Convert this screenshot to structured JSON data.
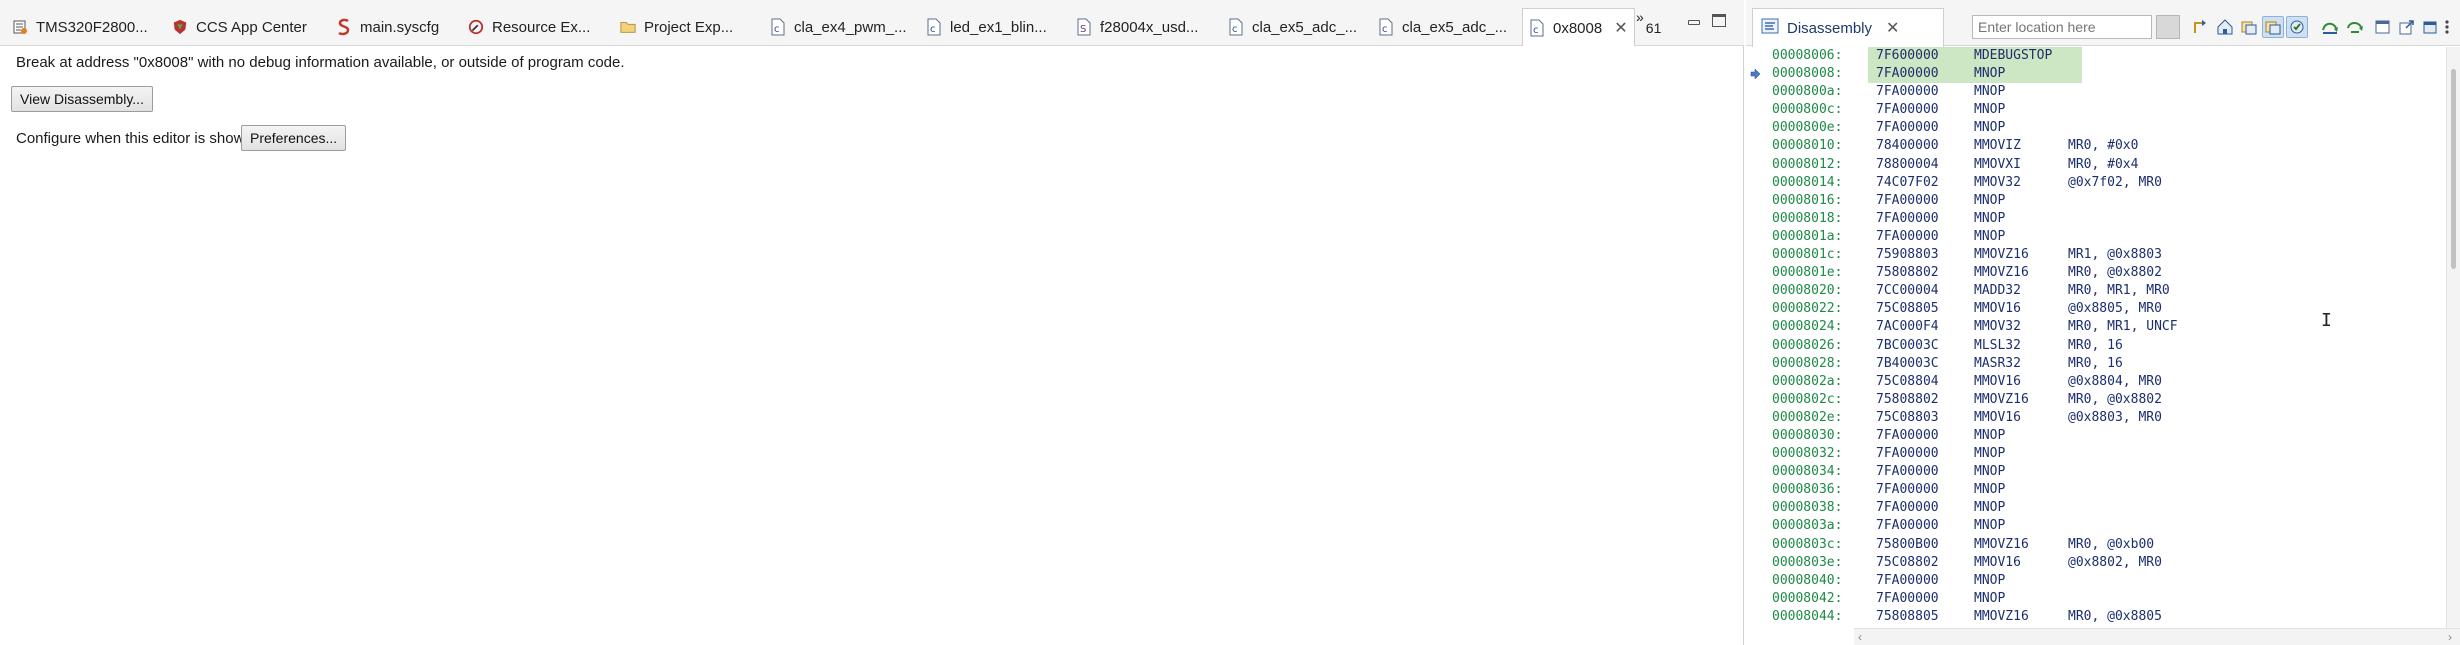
{
  "tabs": [
    {
      "label": "TMS320F2800...",
      "icon": "target-config-icon",
      "active": false
    },
    {
      "label": "CCS App Center",
      "icon": "app-center-icon",
      "active": false
    },
    {
      "label": "main.syscfg",
      "icon": "syscfg-icon",
      "active": false
    },
    {
      "label": "Resource Ex...",
      "icon": "resource-explorer-icon",
      "active": false
    },
    {
      "label": "Project Exp...",
      "icon": "folder-icon",
      "active": false
    },
    {
      "label": "cla_ex4_pwm_...",
      "icon": "c-file-icon",
      "active": false
    },
    {
      "label": "led_ex1_blin...",
      "icon": "c-file-icon",
      "active": false
    },
    {
      "label": "f28004x_usd...",
      "icon": "source-file-icon",
      "active": false
    },
    {
      "label": "cla_ex5_adc_...",
      "icon": "c-file-icon",
      "active": false
    },
    {
      "label": "cla_ex5_adc_...",
      "icon": "c-file-icon",
      "active": false
    },
    {
      "label": "0x8008",
      "icon": "c-file-icon",
      "active": true
    }
  ],
  "overflow": {
    "chevron": "»",
    "count": "61"
  },
  "editor": {
    "message": "Break at address \"0x8008\" with no debug information available, or outside of program code.",
    "view_disassembly_label": "View Disassembly...",
    "configure_label": "Configure when this editor is shown",
    "preferences_label": "Preferences..."
  },
  "disassembly": {
    "tab_label": "Disassembly",
    "location_placeholder": "Enter location here",
    "rows": [
      {
        "addr": "00008006:",
        "op": "7F600000",
        "mn": "MDEBUGSTOP",
        "args": "",
        "hl": true
      },
      {
        "addr": "00008008:",
        "op": "7FA00000",
        "mn": "MNOP",
        "args": "",
        "hl": true
      },
      {
        "addr": "0000800a:",
        "op": "7FA00000",
        "mn": "MNOP",
        "args": ""
      },
      {
        "addr": "0000800c:",
        "op": "7FA00000",
        "mn": "MNOP",
        "args": ""
      },
      {
        "addr": "0000800e:",
        "op": "7FA00000",
        "mn": "MNOP",
        "args": ""
      },
      {
        "addr": "00008010:",
        "op": "78400000",
        "mn": "MMOVIZ",
        "args": "MR0, #0x0"
      },
      {
        "addr": "00008012:",
        "op": "78800004",
        "mn": "MMOVXI",
        "args": "MR0, #0x4"
      },
      {
        "addr": "00008014:",
        "op": "74C07F02",
        "mn": "MMOV32",
        "args": "@0x7f02, MR0"
      },
      {
        "addr": "00008016:",
        "op": "7FA00000",
        "mn": "MNOP",
        "args": ""
      },
      {
        "addr": "00008018:",
        "op": "7FA00000",
        "mn": "MNOP",
        "args": ""
      },
      {
        "addr": "0000801a:",
        "op": "7FA00000",
        "mn": "MNOP",
        "args": ""
      },
      {
        "addr": "0000801c:",
        "op": "75908803",
        "mn": "MMOVZ16",
        "args": "MR1, @0x8803"
      },
      {
        "addr": "0000801e:",
        "op": "75808802",
        "mn": "MMOVZ16",
        "args": "MR0, @0x8802"
      },
      {
        "addr": "00008020:",
        "op": "7CC00004",
        "mn": "MADD32",
        "args": "MR0, MR1, MR0"
      },
      {
        "addr": "00008022:",
        "op": "75C08805",
        "mn": "MMOV16",
        "args": "@0x8805, MR0"
      },
      {
        "addr": "00008024:",
        "op": "7AC000F4",
        "mn": "MMOV32",
        "args": "MR0, MR1, UNCF"
      },
      {
        "addr": "00008026:",
        "op": "7BC0003C",
        "mn": "MLSL32",
        "args": "MR0, 16"
      },
      {
        "addr": "00008028:",
        "op": "7B40003C",
        "mn": "MASR32",
        "args": "MR0, 16"
      },
      {
        "addr": "0000802a:",
        "op": "75C08804",
        "mn": "MMOV16",
        "args": "@0x8804, MR0"
      },
      {
        "addr": "0000802c:",
        "op": "75808802",
        "mn": "MMOVZ16",
        "args": "MR0, @0x8802"
      },
      {
        "addr": "0000802e:",
        "op": "75C08803",
        "mn": "MMOV16",
        "args": "@0x8803, MR0"
      },
      {
        "addr": "00008030:",
        "op": "7FA00000",
        "mn": "MNOP",
        "args": ""
      },
      {
        "addr": "00008032:",
        "op": "7FA00000",
        "mn": "MNOP",
        "args": ""
      },
      {
        "addr": "00008034:",
        "op": "7FA00000",
        "mn": "MNOP",
        "args": ""
      },
      {
        "addr": "00008036:",
        "op": "7FA00000",
        "mn": "MNOP",
        "args": ""
      },
      {
        "addr": "00008038:",
        "op": "7FA00000",
        "mn": "MNOP",
        "args": ""
      },
      {
        "addr": "0000803a:",
        "op": "7FA00000",
        "mn": "MNOP",
        "args": ""
      },
      {
        "addr": "0000803c:",
        "op": "75800B00",
        "mn": "MMOVZ16",
        "args": "MR0, @0xb00"
      },
      {
        "addr": "0000803e:",
        "op": "75C08802",
        "mn": "MMOV16",
        "args": "@0x8802, MR0"
      },
      {
        "addr": "00008040:",
        "op": "7FA00000",
        "mn": "MNOP",
        "args": ""
      },
      {
        "addr": "00008042:",
        "op": "7FA00000",
        "mn": "MNOP",
        "args": ""
      },
      {
        "addr": "00008044:",
        "op": "75808805",
        "mn": "MMOVZ16",
        "args": "MR0, @0x8805"
      }
    ],
    "toolbar_icons": [
      "go-icon",
      "step-into-icon",
      "home-icon",
      "link-icon",
      "link-icon",
      "view-opcodes-icon",
      "step-over-icon",
      "refresh-icon",
      "new-view-icon",
      "export-icon",
      "pin-icon",
      "menu-icon"
    ]
  },
  "colors": {
    "address": "#1e8a46",
    "instruction": "#1c2e6e",
    "highlight": "#cde7c4"
  }
}
